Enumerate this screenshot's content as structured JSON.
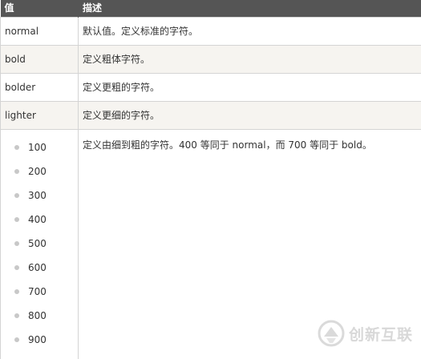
{
  "table": {
    "headers": [
      "值",
      "描述"
    ],
    "rows": [
      {
        "value": "normal",
        "description": "默认值。定义标准的字符。"
      },
      {
        "value": "bold",
        "description": "定义粗体字符。"
      },
      {
        "value": "bolder",
        "description": "定义更粗的字符。"
      },
      {
        "value": "lighter",
        "description": "定义更细的字符。"
      },
      {
        "values": [
          "100",
          "200",
          "300",
          "400",
          "500",
          "600",
          "700",
          "800",
          "900"
        ],
        "description": "定义由细到粗的字符。400 等同于 normal，而 700 等同于 bold。"
      }
    ]
  },
  "watermark": {
    "text": "创新互联"
  },
  "colors": {
    "header_bg": "#555555",
    "alt_row_bg": "#f6f4f0",
    "border": "#d4d4d4",
    "bullet": "#c8c8c8"
  }
}
